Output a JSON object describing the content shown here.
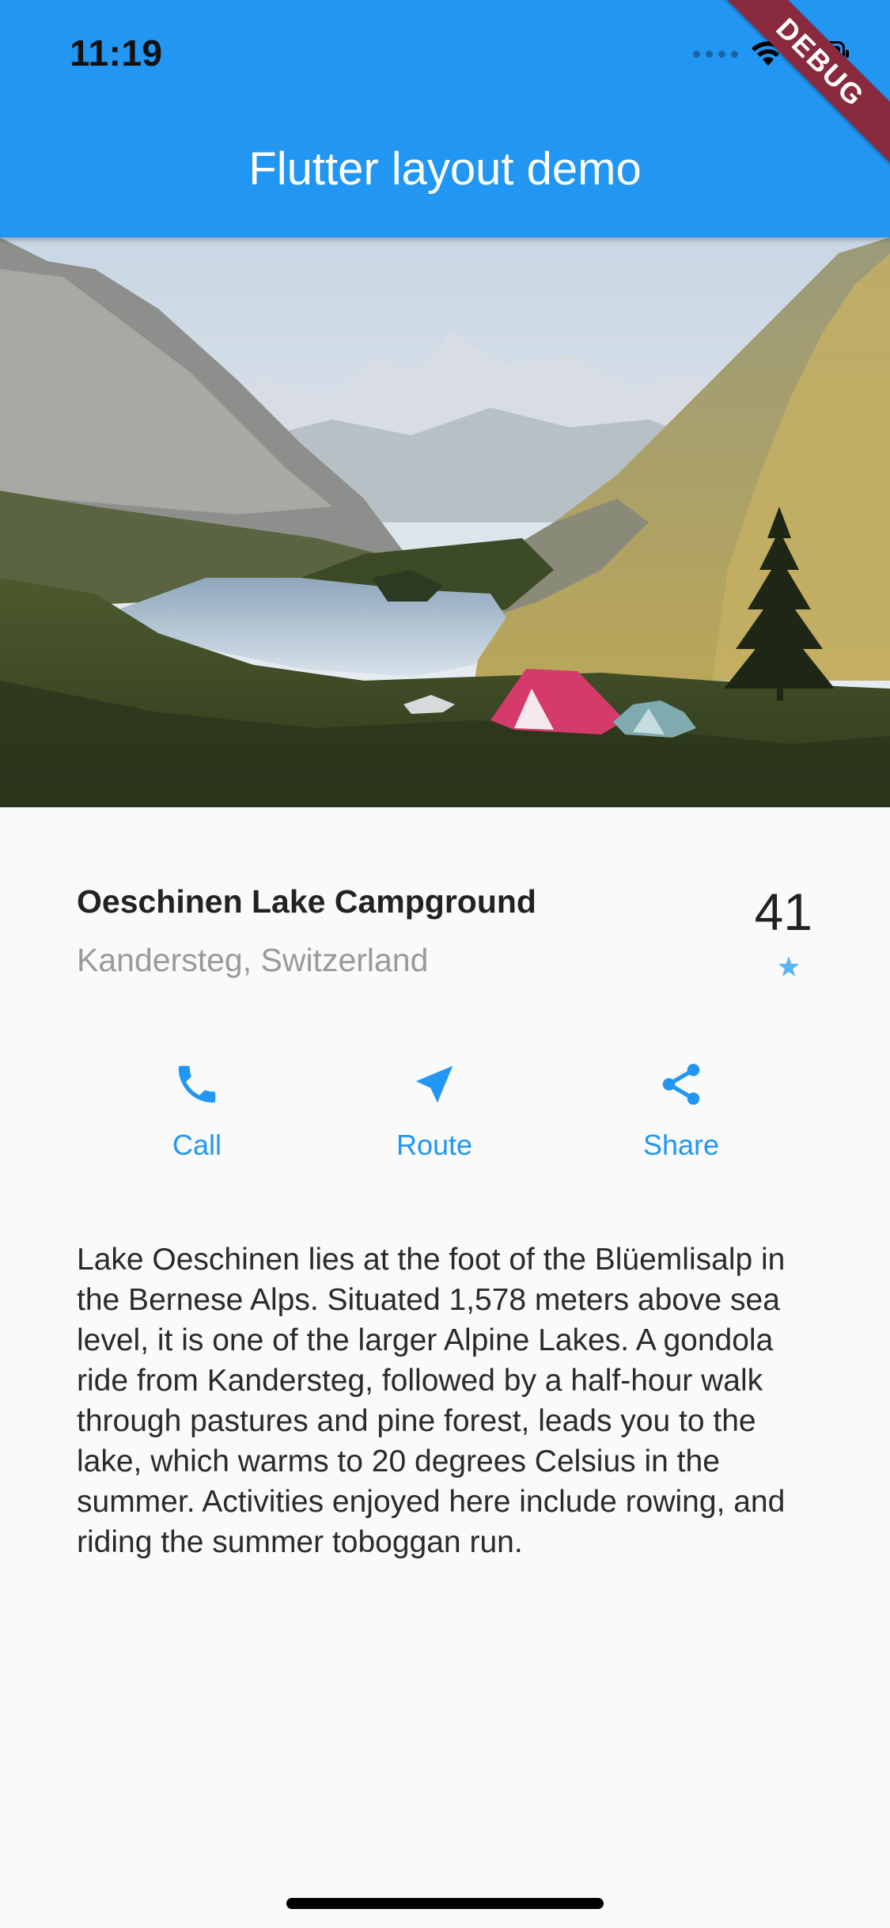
{
  "status_bar": {
    "time": "11:19"
  },
  "debug_banner": "DEBUG",
  "app_bar": {
    "title": "Flutter layout demo",
    "color": "#2196f3"
  },
  "place": {
    "name": "Oeschinen Lake Campground",
    "location": "Kandersteg, Switzerland",
    "rating_count": "41",
    "rating_icon": "star-icon"
  },
  "actions": [
    {
      "label": "Call",
      "icon": "phone-icon"
    },
    {
      "label": "Route",
      "icon": "navigation-arrow-icon"
    },
    {
      "label": "Share",
      "icon": "share-icon"
    }
  ],
  "description": "Lake Oeschinen lies at the foot of the Blüemlisalp in the Bernese Alps. Situated 1,578 meters above sea level, it is one of the larger Alpine Lakes. A gondola ride from Kandersteg, followed by a half-hour walk through pastures and pine forest, leads you to the lake, which warms to 20 degrees Celsius in the summer. Activities enjoyed here include rowing, and riding the summer toboggan run.",
  "colors": {
    "accent": "#2196f3",
    "star": "#5ab4f0",
    "debug_banner": "#8a2a3e"
  }
}
